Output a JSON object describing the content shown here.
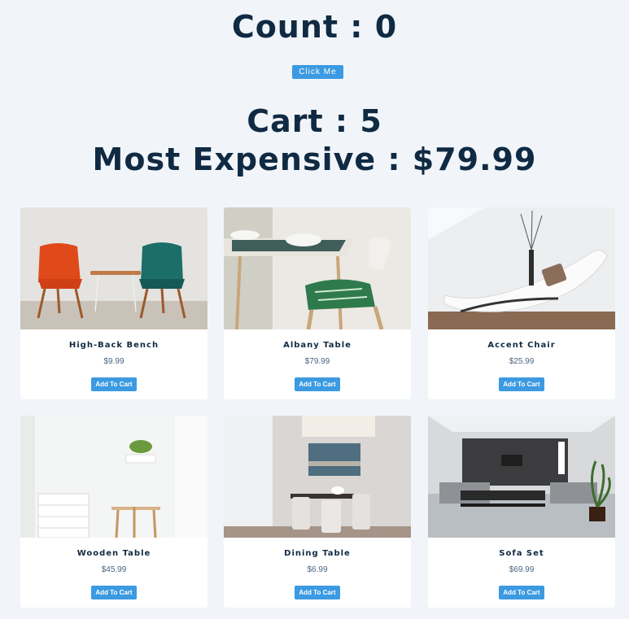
{
  "counter": {
    "label": "Count : 0",
    "button_label": "Click Me"
  },
  "cart": {
    "label": "Cart : 5",
    "most_expensive_label": "Most Expensive : $79.99"
  },
  "products": [
    {
      "name": "High-Back Bench",
      "price": "$9.99",
      "button_label": "Add To Cart"
    },
    {
      "name": "Albany Table",
      "price": "$79.99",
      "button_label": "Add To Cart"
    },
    {
      "name": "Accent Chair",
      "price": "$25.99",
      "button_label": "Add To Cart"
    },
    {
      "name": "Wooden Table",
      "price": "$45.99",
      "button_label": "Add To Cart"
    },
    {
      "name": "Dining Table",
      "price": "$6.99",
      "button_label": "Add To Cart"
    },
    {
      "name": "Sofa Set",
      "price": "$69.99",
      "button_label": "Add To Cart"
    }
  ],
  "colors": {
    "background": "#f1f5f9",
    "heading": "#102a43",
    "button": "#3b9ae1"
  }
}
